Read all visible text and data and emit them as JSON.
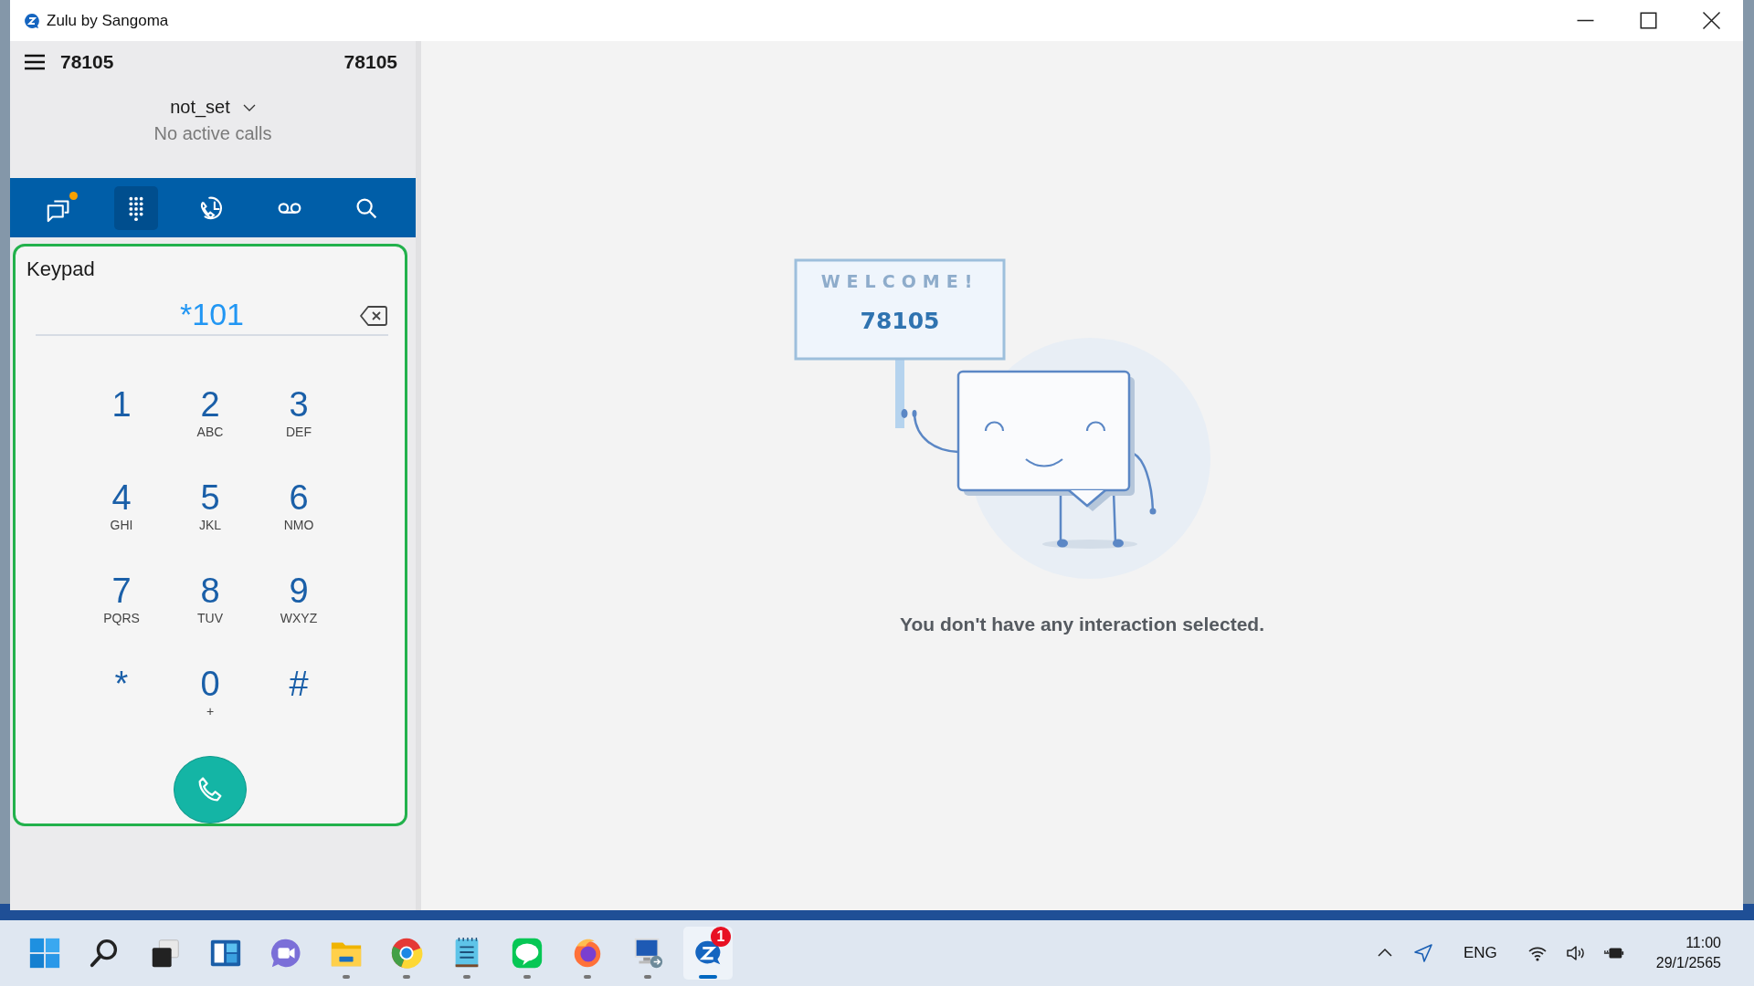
{
  "window": {
    "title": "Zulu by Sangoma"
  },
  "sidebar": {
    "header": {
      "extension": "78105",
      "number": "78105"
    },
    "status": {
      "presence": "not_set",
      "calls": "No active calls"
    },
    "nav_tabs": [
      {
        "kind": "chats",
        "selected": false,
        "unread": true
      },
      {
        "kind": "keypad",
        "selected": true,
        "unread": false
      },
      {
        "kind": "history",
        "selected": false,
        "unread": false
      },
      {
        "kind": "voicemail",
        "selected": false,
        "unread": false
      },
      {
        "kind": "search",
        "selected": false,
        "unread": false
      }
    ],
    "keypad": {
      "title": "Keypad",
      "value": "*101",
      "keys": [
        {
          "digit": "1"
        },
        {
          "digit": "2",
          "letters": "ABC"
        },
        {
          "digit": "3",
          "letters": "DEF"
        },
        {
          "digit": "4",
          "letters": "GHI"
        },
        {
          "digit": "5",
          "letters": "JKL"
        },
        {
          "digit": "6",
          "letters": "NMO"
        },
        {
          "digit": "7",
          "letters": "PQRS"
        },
        {
          "digit": "8",
          "letters": "TUV"
        },
        {
          "digit": "9",
          "letters": "WXYZ"
        },
        {
          "digit": "*"
        },
        {
          "digit": "0",
          "letters": "+"
        },
        {
          "digit": "#"
        }
      ]
    }
  },
  "main": {
    "sign_heading": "WELCOME!",
    "sign_number": "78105",
    "message": "You don't have any interaction selected."
  },
  "taskbar": {
    "apps": [
      {
        "kind": "start",
        "running": false,
        "selected": false
      },
      {
        "kind": "search",
        "running": false,
        "selected": false
      },
      {
        "kind": "task-view",
        "running": false,
        "selected": false
      },
      {
        "kind": "widgets",
        "running": false,
        "selected": false
      },
      {
        "kind": "chat",
        "running": false,
        "selected": false
      },
      {
        "kind": "files",
        "running": true,
        "selected": false
      },
      {
        "kind": "browser",
        "running": true,
        "selected": false
      },
      {
        "kind": "notepad",
        "running": true,
        "selected": false
      },
      {
        "kind": "line",
        "running": true,
        "selected": false
      },
      {
        "kind": "firefox",
        "running": true,
        "selected": false
      },
      {
        "kind": "remote",
        "running": true,
        "selected": false
      },
      {
        "kind": "zulu",
        "running": true,
        "selected": true,
        "badge": "1"
      }
    ],
    "language": "ENG",
    "time": "11:00",
    "date": "29/1/2565"
  }
}
